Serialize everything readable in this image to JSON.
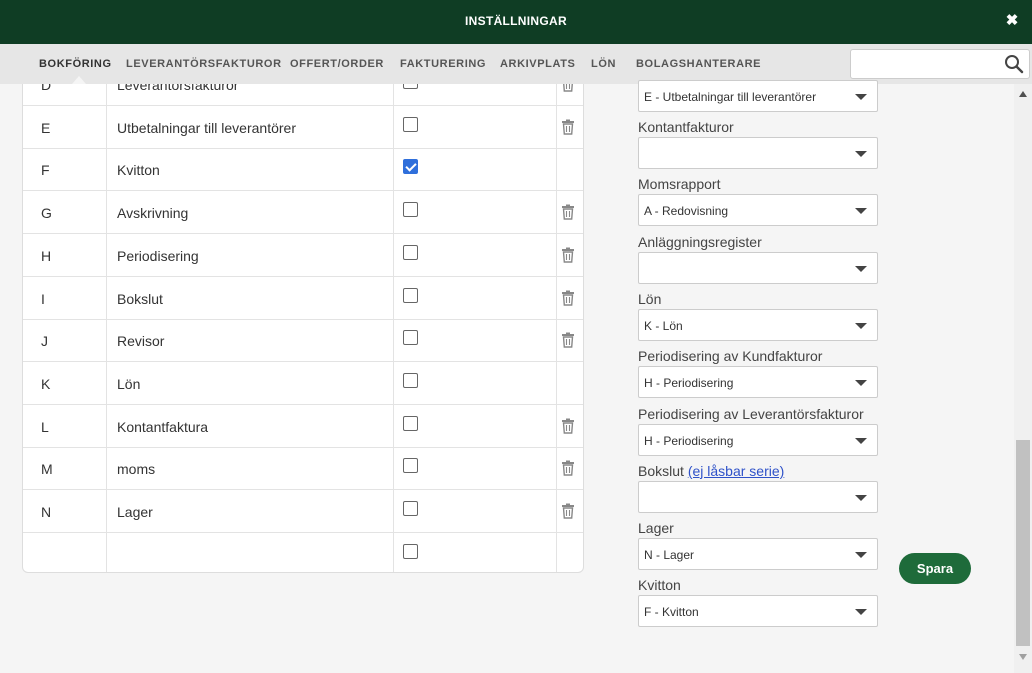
{
  "dialog": {
    "title": "INSTÄLLNINGAR",
    "close_icon": "close-icon"
  },
  "tabs": [
    {
      "label": "BOKFÖRING",
      "active": true
    },
    {
      "label": "LEVERANTÖRSFAKTUROR"
    },
    {
      "label": "OFFERT/ORDER"
    },
    {
      "label": "FAKTURERING"
    },
    {
      "label": "ARKIVPLATS"
    },
    {
      "label": "LÖN"
    },
    {
      "label": "BOLAGSHANTERARE"
    }
  ],
  "search": {
    "placeholder": "",
    "icon": "search-icon"
  },
  "series_table": {
    "rows": [
      {
        "letter": "D",
        "name": "Leverantörsfakturor",
        "checked": false,
        "deletable": true
      },
      {
        "letter": "E",
        "name": "Utbetalningar till leverantörer",
        "checked": false,
        "deletable": true
      },
      {
        "letter": "F",
        "name": "Kvitton",
        "checked": true,
        "deletable": false
      },
      {
        "letter": "G",
        "name": "Avskrivning",
        "checked": false,
        "deletable": true
      },
      {
        "letter": "H",
        "name": "Periodisering",
        "checked": false,
        "deletable": true
      },
      {
        "letter": "I",
        "name": "Bokslut",
        "checked": false,
        "deletable": true
      },
      {
        "letter": "J",
        "name": "Revisor",
        "checked": false,
        "deletable": true
      },
      {
        "letter": "K",
        "name": "Lön",
        "checked": false,
        "deletable": false
      },
      {
        "letter": "L",
        "name": "Kontantfaktura",
        "checked": false,
        "deletable": true
      },
      {
        "letter": "M",
        "name": "moms",
        "checked": false,
        "deletable": true
      },
      {
        "letter": "N",
        "name": "Lager",
        "checked": false,
        "deletable": true
      },
      {
        "letter": "",
        "name": "",
        "checked": false,
        "deletable": false
      }
    ]
  },
  "settings": {
    "top_select_value": "E - Utbetalningar till leverantörer",
    "fields": [
      {
        "label": "Kontantfakturor",
        "value": ""
      },
      {
        "label": "Momsrapport",
        "value": "A - Redovisning"
      },
      {
        "label": "Anläggningsregister",
        "value": ""
      },
      {
        "label": "Lön",
        "value": "K - Lön"
      },
      {
        "label": "Periodisering av Kundfakturor",
        "value": "H - Periodisering"
      },
      {
        "label": "Periodisering av Leverantörsfakturor",
        "value": "H - Periodisering"
      },
      {
        "label": "Bokslut",
        "link": "(ej låsbar serie)",
        "value": ""
      },
      {
        "label": "Lager",
        "value": "N - Lager"
      },
      {
        "label": "Kvitton",
        "value": "F - Kvitton"
      }
    ]
  },
  "save_button": {
    "label": "Spara"
  },
  "colors": {
    "header_bg": "#0f3d24",
    "save_bg": "#1e6b3a",
    "checkbox_checked": "#2f6fdb",
    "link": "#2f52c9"
  }
}
